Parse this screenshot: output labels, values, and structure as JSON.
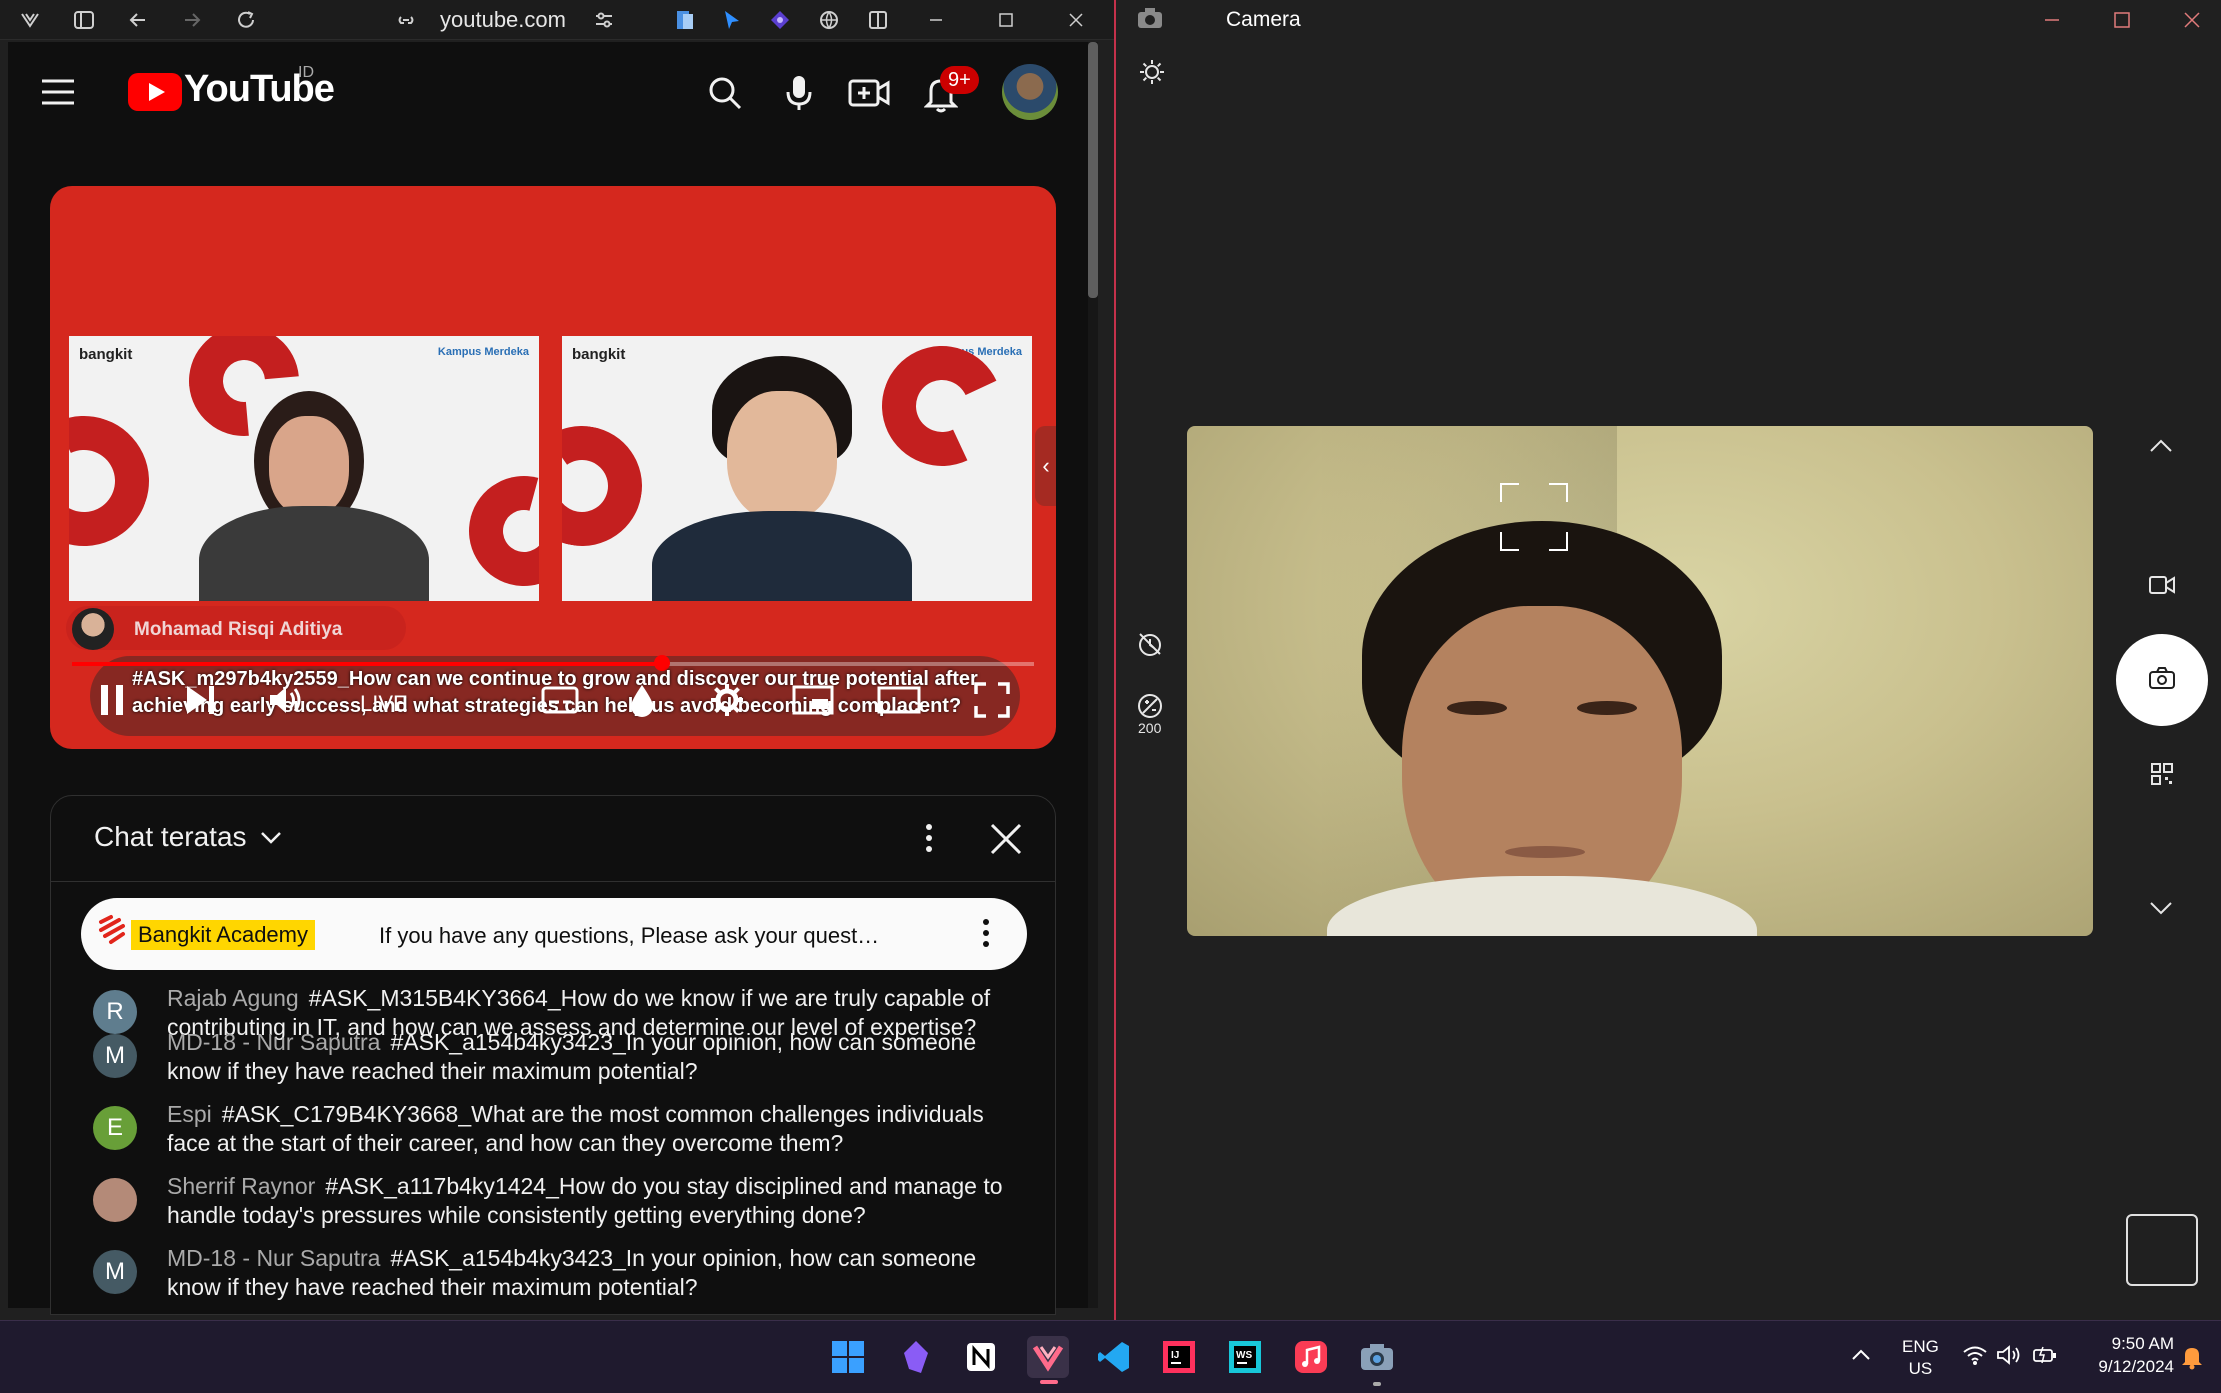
{
  "browser": {
    "url": "youtube.com"
  },
  "youtube": {
    "logo": "YouTube",
    "country_code": "ID",
    "notification_count": "9+",
    "video": {
      "speaker_name": "Mohamad Risqi Aditiya",
      "panel_brand": "bangkit",
      "panel_partner": "Kampus Merdeka",
      "caption": "#ASK_m297b4ky2559_How can we continue to grow and discover our true potential after achieving early success, and what strategies can help us avoid becoming complacent?",
      "live_label": "LIVE",
      "progress_fraction": 0.62
    },
    "chat": {
      "title": "Chat teratas",
      "pinned": {
        "author": "Bangkit Academy",
        "message": "If you have any questions, Please ask your quest…"
      },
      "messages": [
        {
          "avatar_letter": "R",
          "avatar_color": "#5f7d8e",
          "author": "Rajab Agung",
          "text": "#ASK_M315B4KY3664_How do we know if we are truly capable of contributing in IT, and how can we assess and determine our level of expertise?"
        },
        {
          "avatar_letter": "M",
          "avatar_color": "#455a64",
          "author": "MD-18 - Nur Saputra",
          "text": "#ASK_a154b4ky3423_In your opinion, how can someone know if they have reached their maximum potential?"
        },
        {
          "avatar_letter": "E",
          "avatar_color": "#689f38",
          "author": "Espi",
          "text": "#ASK_C179B4KY3668_What are the most common challenges individuals face at the start of their career, and how can they overcome them?"
        },
        {
          "avatar_letter": "",
          "avatar_color": "#b48a78",
          "author": "Sherrif Raynor",
          "text": "#ASK_a117b4ky1424_How do you stay disciplined and manage to handle today's pressures while consistently getting everything done?"
        },
        {
          "avatar_letter": "M",
          "avatar_color": "#455a64",
          "author": "MD-18 - Nur Saputra",
          "text": "#ASK_a154b4ky3423_In your opinion, how can someone know if they have reached their maximum potential?"
        }
      ]
    }
  },
  "camera": {
    "title": "Camera",
    "brightness_value": "200"
  },
  "taskbar": {
    "lang_line1": "ENG",
    "lang_line2": "US",
    "time": "9:50 AM",
    "date": "9/12/2024"
  },
  "colors": {
    "yt_red": "#ff0000",
    "video_red": "#d5281e",
    "camera_accent": "#c4314b",
    "pinned_highlight": "#ffd600"
  }
}
